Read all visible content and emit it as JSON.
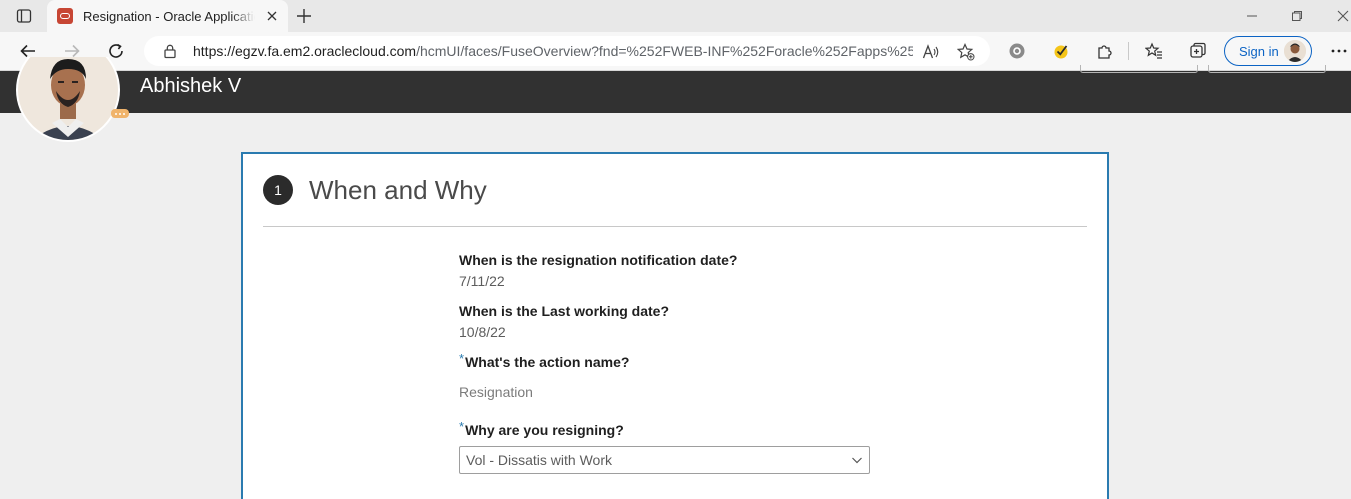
{
  "browser": {
    "tab_title": "Resignation - Oracle Applications",
    "url_host": "https://egzv.fa.em2.oraclecloud.com",
    "url_path": "/hcmUI/faces/FuseOverview?fnd=%252FWEB-INF%252Foracle%252Fapps%25...",
    "signin_label": "Sign in"
  },
  "header": {
    "person_name": "Abhishek V"
  },
  "section": {
    "step_number": "1",
    "title": "When and Why"
  },
  "form": {
    "notification_date_label": "When is the resignation notification date?",
    "notification_date_value": "7/11/22",
    "last_working_date_label": "When is the Last working date?",
    "last_working_date_value": "10/8/22",
    "action_name_label": "What's the action name?",
    "action_name_value": "Resignation",
    "reason_label": "Why are you resigning?",
    "reason_value": "Vol - Dissatis with Work",
    "required_marker": "*"
  },
  "colors": {
    "accent": "#2a7bb0",
    "banner": "#313131",
    "oracle_red": "#c74634"
  }
}
